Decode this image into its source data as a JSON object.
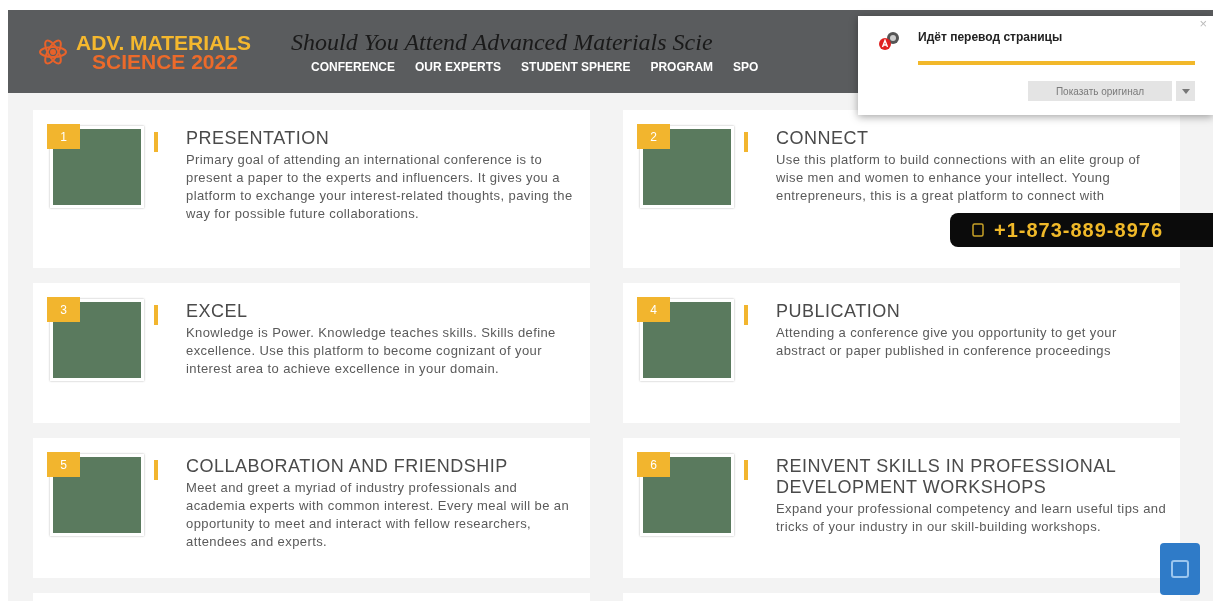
{
  "header": {
    "logo_line_1": "ADV. MATERIALS",
    "logo_line_2": "SCIENCE 2022",
    "tagline": "Should You Attend Advanced Materials Scie",
    "nav": [
      {
        "label": "CONFERENCE"
      },
      {
        "label": "OUR EXPERTS"
      },
      {
        "label": "STUDENT SPHERE"
      },
      {
        "label": "PROGRAM"
      },
      {
        "label": "SPO"
      }
    ]
  },
  "cards": [
    {
      "number": "1",
      "title": "PRESENTATION",
      "text": "Primary goal of attending an international conference is to present a paper to the experts and influencers. It gives you a platform to exchange your interest-related thoughts, paving the way for possible future collaborations."
    },
    {
      "number": "2",
      "title": "CONNECT",
      "text": "Use this platform to build connections with an elite group of wise men and women to enhance your intellect. Young entrepreneurs, this is a great platform to connect with"
    },
    {
      "number": "3",
      "title": "EXCEL",
      "text": "Knowledge is Power. Knowledge teaches skills. Skills define excellence. Use this platform to become cognizant of your interest area to achieve excellence in your domain."
    },
    {
      "number": "4",
      "title": "PUBLICATION",
      "text": "Attending a conference give you opportunity to get your abstract or paper published in conference proceedings"
    },
    {
      "number": "5",
      "title": "COLLABORATION AND FRIENDSHIP",
      "text": "Meet and greet a myriad of industry professionals and academia experts with common interest. Every meal will be an opportunity to meet and interact with fellow researchers, attendees and experts."
    },
    {
      "number": "6",
      "title": "REINVENT SKILLS IN PROFESSIONAL DEVELOPMENT WORKSHOPS",
      "text": "Expand your professional competency and learn useful tips and tricks of your industry in our skill-building workshops."
    }
  ],
  "phone_badge": {
    "number": "+1-873-889-8976"
  },
  "translate_popup": {
    "title": "Идёт перевод страницы",
    "button": {
      "label": "Показать оригинал",
      "disabled": true
    },
    "close": "×"
  }
}
